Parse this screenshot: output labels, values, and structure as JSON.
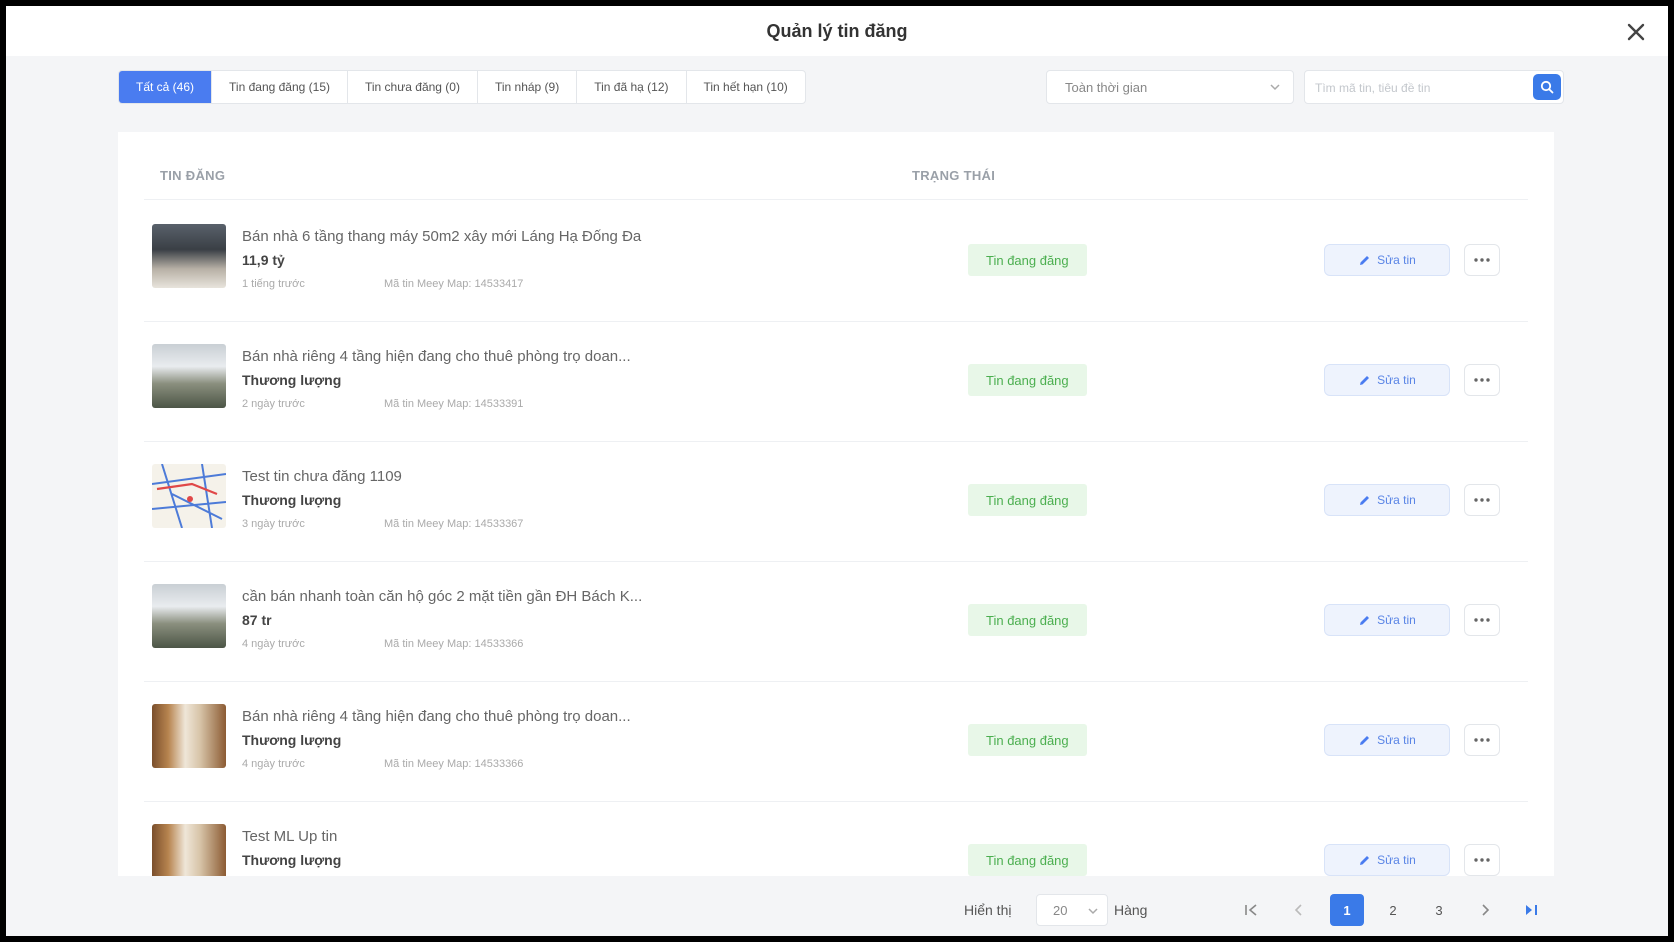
{
  "modal": {
    "title": "Quản lý tin đăng"
  },
  "tabs": [
    {
      "label": "Tất cả (46)",
      "active": true
    },
    {
      "label": "Tin đang đăng (15)"
    },
    {
      "label": "Tin chưa đăng (0)"
    },
    {
      "label": "Tin nháp (9)"
    },
    {
      "label": "Tin đã hạ (12)"
    },
    {
      "label": "Tin hết hạn (10)"
    }
  ],
  "filters": {
    "time_value": "Toàn thời gian",
    "search_placeholder": "Tìm mã tin, tiêu đề tin"
  },
  "table": {
    "col_listing": "TIN ĐĂNG",
    "col_status": "TRẠNG THÁI",
    "rows": [
      {
        "title": "Bán nhà 6 tầng thang máy 50m2 xây mới Láng Hạ Đống Đa",
        "price": "11,9 tỷ",
        "time": "1 tiếng trước",
        "code": "Mã tin Meey Map: 14533417",
        "status": "Tin đang đăng",
        "edit_label": "Sửa tin",
        "thumb": "photo-dark"
      },
      {
        "title": "Bán nhà riêng 4 tầng hiện đang cho thuê phòng trọ doan...",
        "price": "Thương lượng",
        "time": "2 ngày trước",
        "code": "Mã tin Meey Map: 14533391",
        "status": "Tin đang đăng",
        "edit_label": "Sửa tin",
        "thumb": "photo-light"
      },
      {
        "title": "Test tin chưa đăng 1109",
        "price": "Thương lượng",
        "time": "3 ngày trước",
        "code": "Mã tin Meey Map: 14533367",
        "status": "Tin đang đăng",
        "edit_label": "Sửa tin",
        "thumb": "map"
      },
      {
        "title": "cần bán nhanh toàn căn hộ góc 2 mặt tiền gần ĐH Bách K...",
        "price": "87 tr",
        "time": "4 ngày trước",
        "code": "Mã tin Meey Map: 14533366",
        "status": "Tin đang đăng",
        "edit_label": "Sửa tin",
        "thumb": "photo-light"
      },
      {
        "title": "Bán nhà riêng 4 tầng hiện đang cho thuê phòng trọ doan...",
        "price": "Thương lượng",
        "time": "4 ngày trước",
        "code": "Mã tin Meey Map: 14533366",
        "status": "Tin đang đăng",
        "edit_label": "Sửa tin",
        "thumb": "photo-wood"
      },
      {
        "title": "Test ML Up tin",
        "price": "Thương lượng",
        "time": "",
        "code": "",
        "status": "Tin đang đăng",
        "edit_label": "Sửa tin",
        "thumb": "photo-wood"
      }
    ]
  },
  "pagination": {
    "show_label": "Hiển thị",
    "page_size": "20",
    "rows_label": "Hàng",
    "pages": [
      "1",
      "2",
      "3"
    ],
    "current": "1"
  },
  "colors": {
    "primary": "#3a7ae8",
    "status_green": "#4caf50",
    "status_bg": "#e8f7e8"
  }
}
